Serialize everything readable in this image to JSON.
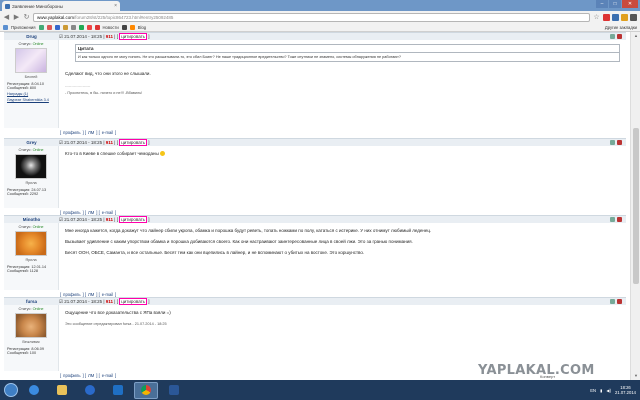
{
  "window": {
    "tab_title": "Заявление Минобороны",
    "minimize": "–",
    "maximize": "□",
    "close": "✕"
  },
  "address_bar": {
    "domain": "www.yaplakal.com",
    "path": "/forum28/st/225/topic864723.html#entry25092485"
  },
  "bookmarks": {
    "items": [
      "Приложения",
      "Новости",
      "Blog"
    ],
    "other": "Другие закладки"
  },
  "posts": [
    {
      "author": "Drug",
      "date": "21.07.2014 - 18:25",
      "status_label": "Статус:",
      "status": "Online",
      "rank": "Беспей",
      "reg_label": "Регистрация:",
      "reg": "8.04.10",
      "msgs_label": "Сообщений:",
      "msgs": "800",
      "awards": "Награды (1)",
      "award_extra": "Лауреат Shabernikla 3.4",
      "quote_head": "Цитата",
      "quote_text": "И как только одного не могу понять. Не кто расшатывали-то, это сбил Боинг? Не наше традиционное вредительство? Тоже спутники не знамено, системы обнаружения не работают?",
      "text": "Сделают вид, что они этого не слышали.",
      "sig_line": "--------------------",
      "sig": "- Проснитесь, в бы- ничего и не!!! -Вбавиль!"
    },
    {
      "author": "Grey",
      "date": "21.07.2014 - 18:25",
      "status_label": "Статус:",
      "status": "Online",
      "rank": "Ярила",
      "reg_label": "Регистрация:",
      "reg": "24.07.13",
      "msgs_label": "Сообщений:",
      "msgs": "2292",
      "text": "Кто-то в Киеве в спешке собирает чемоданы"
    },
    {
      "author": "Minotho",
      "date": "21.07.2014 - 18:25",
      "status_label": "Статус:",
      "status": "Online",
      "rank": "Ярила",
      "reg_label": "Регистрация:",
      "reg": "12.01.14",
      "msgs_label": "Сообщений:",
      "msgs": "1128",
      "p1": "Мне иногда кажется, когда докажут что лайнер сбили укропа, обамка и порошка будут реветь, топать ножками по полу, кататься с истерике. У них отнимут любимый леденец.",
      "p2": "Вызывает удивление с каким упорством обамка и порошка добиваются своего. Как они настраивают заинтересованные лица в своей лжи. Это за гранью понимания.",
      "p3": "Бесят ООН, ОБСЕ, Саманта, и все остальные. Бесят тем как они вцепились в лайнер, и не вспоминают о убитых на востоке. Это коршунство."
    },
    {
      "author": "fursa",
      "date": "21.07.2014 - 18:25",
      "status_label": "Статус:",
      "status": "Online",
      "rank": "Вежливик",
      "reg_label": "Регистрация:",
      "reg": "8.06.09",
      "msgs_label": "Сообщений:",
      "msgs": "100",
      "text": "Ощущение что все доказательства с ЯПа взяли =)",
      "note": "Это сообщение отредактировал fursa - 21.07.2014 - 18:25"
    }
  ],
  "post_meta": {
    "num": "911",
    "cite": "цитировать",
    "foot_profile": "профиль",
    "foot_pm": "ЛМ",
    "foot_email": "e-mail"
  },
  "scroll": {
    "up": "▲",
    "down": "▼",
    "bottom_label": "Конверт"
  },
  "watermark": "YAPLAKAL.COM",
  "taskbar": {
    "lang": "EN",
    "time": "18:26",
    "date": "21.07.2014"
  }
}
